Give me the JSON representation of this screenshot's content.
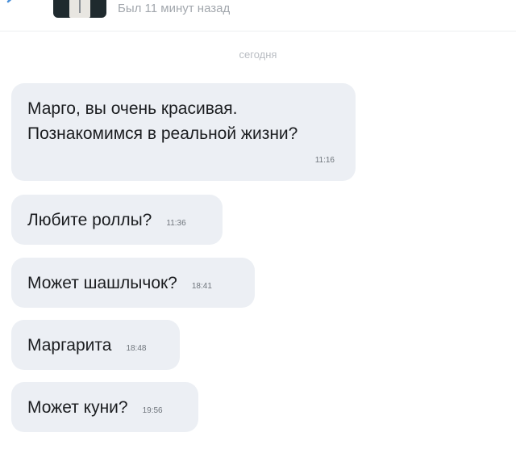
{
  "header": {
    "back_icon": "chevron-left-icon",
    "status": "Был 11 минут назад"
  },
  "chat": {
    "date_separator": "сегодня",
    "messages": [
      {
        "text": "Марго, вы очень красивая.\nПознакомимся в реальной жизни?",
        "time": "11:16"
      },
      {
        "text": "Любите роллы?",
        "time": "11:36"
      },
      {
        "text": "Может шашлычок?",
        "time": "18:41"
      },
      {
        "text": "Маргарита",
        "time": "18:48"
      },
      {
        "text": "Может куни?",
        "time": "19:56"
      }
    ]
  },
  "colors": {
    "bubble_bg": "#eceff4",
    "status_text": "#a2a7ad",
    "separator_text": "#b8bcc2",
    "back_icon": "#4a90d9"
  }
}
